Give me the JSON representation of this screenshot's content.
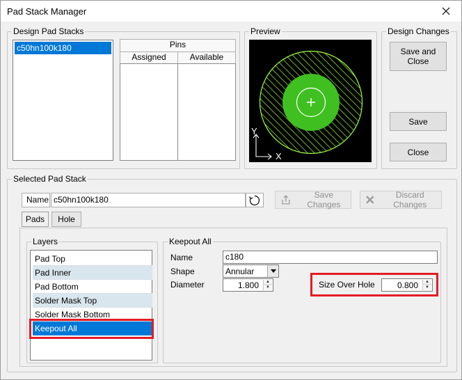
{
  "window": {
    "title": "Pad Stack Manager",
    "close_glyph": "✕"
  },
  "design_pad_stacks": {
    "legend": "Design Pad Stacks",
    "items": [
      "c50hn100k180"
    ],
    "selected": "c50hn100k180"
  },
  "pins": {
    "header": "Pins",
    "columns": [
      "Assigned",
      "Available"
    ]
  },
  "preview": {
    "legend": "Preview",
    "y_label": "Y",
    "x_label": "X"
  },
  "design_changes": {
    "legend": "Design Changes",
    "save_and_close": "Save and Close",
    "save": "Save",
    "close": "Close"
  },
  "selected_pad_stack": {
    "legend": "Selected Pad Stack",
    "name_label": "Name",
    "name_value": "c50hn100k180",
    "save_changes": "Save Changes",
    "discard_changes": "Discard Changes",
    "tabs": [
      "Pads",
      "Hole"
    ],
    "active_tab": "Pads"
  },
  "layers": {
    "legend": "Layers",
    "items": [
      "Pad Top",
      "Pad Inner",
      "Pad Bottom",
      "Solder Mask Top",
      "Solder Mask Bottom",
      "Keepout All"
    ],
    "selected": "Keepout All"
  },
  "properties": {
    "legend": "Keepout All",
    "name_label": "Name",
    "name_value": "c180",
    "shape_label": "Shape",
    "shape_value": "Annular",
    "diameter_label": "Diameter",
    "diameter_value": "1.800",
    "size_over_hole_label": "Size Over Hole",
    "size_over_hole_value": "0.800"
  },
  "colors": {
    "selection": "#0078d7",
    "highlight_box": "#e31c24",
    "preview_bg": "#000000",
    "pad_green": "#40c020",
    "hatch_green": "#9eff3f"
  }
}
